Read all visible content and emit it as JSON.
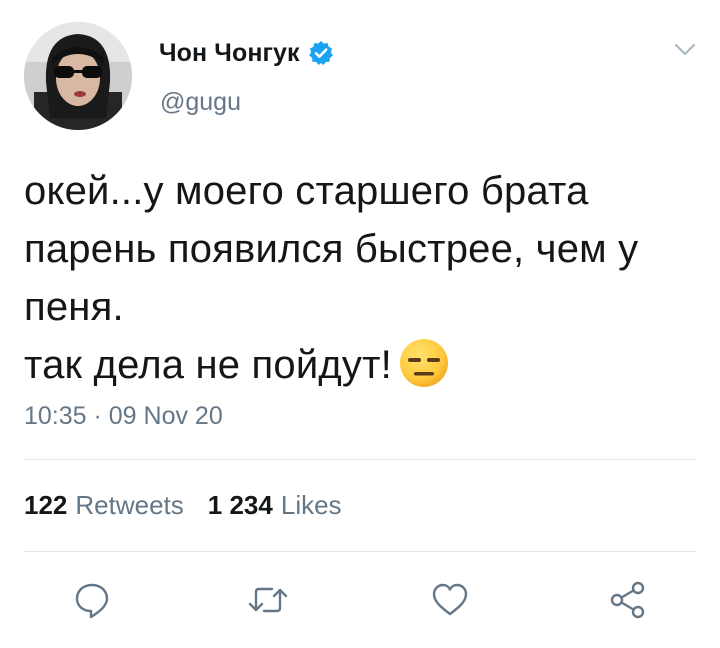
{
  "tweet": {
    "author": {
      "display_name": "Чон Чонгук",
      "handle": "@gugu",
      "verified": true
    },
    "text_lines": [
      "окей...у моего старшего брата",
      "парень появился быстрее, чем у",
      "пеня.",
      "так дела не пойдут!"
    ],
    "emoji": "expressionless-face",
    "timestamp": "10:35 · 09 Nov 20",
    "stats": {
      "retweets_count": "122",
      "retweets_label": "Retweets",
      "likes_count": "1 234",
      "likes_label": "Likes"
    },
    "actions": [
      "reply-icon",
      "retweet-icon",
      "like-icon",
      "share-icon"
    ],
    "colors": {
      "text": "#14171a",
      "secondary": "#657786",
      "verified": "#1da1f2",
      "divider": "#e1e8ed"
    }
  }
}
